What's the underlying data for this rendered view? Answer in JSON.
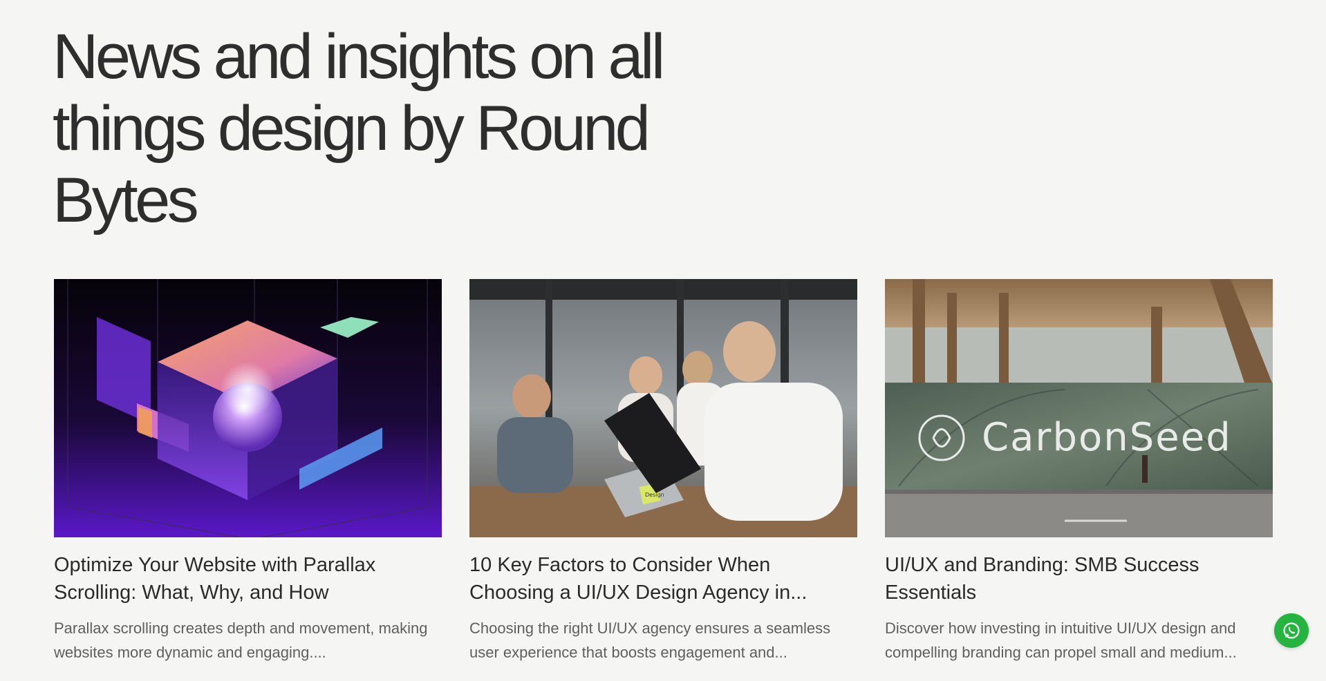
{
  "headline": "News and insights on all things design by Round Bytes",
  "posts": [
    {
      "title": "Optimize Your Website with Parallax Scrolling: What, Why, and How",
      "excerpt": "Parallax scrolling creates depth and movement, making websites more dynamic and engaging....",
      "image_icon": "parallax-cube-illustration"
    },
    {
      "title": "10 Key Factors to Consider When Choosing a UI/UX Design Agency in...",
      "excerpt": "Choosing the right UI/UX agency ensures a seamless user experience that boosts engagement and...",
      "image_icon": "team-meeting-photo",
      "sticky_note": "Design"
    },
    {
      "title": "UI/UX and Branding: SMB Success Essentials",
      "excerpt": "Discover how investing in intuitive UI/UX design and compelling branding can propel small and medium...",
      "image_icon": "carbonseed-wall-photo",
      "brand_text": "CarbonSeed"
    }
  ],
  "whatsapp": {
    "icon": "whatsapp-icon",
    "color": "#25b43f"
  }
}
